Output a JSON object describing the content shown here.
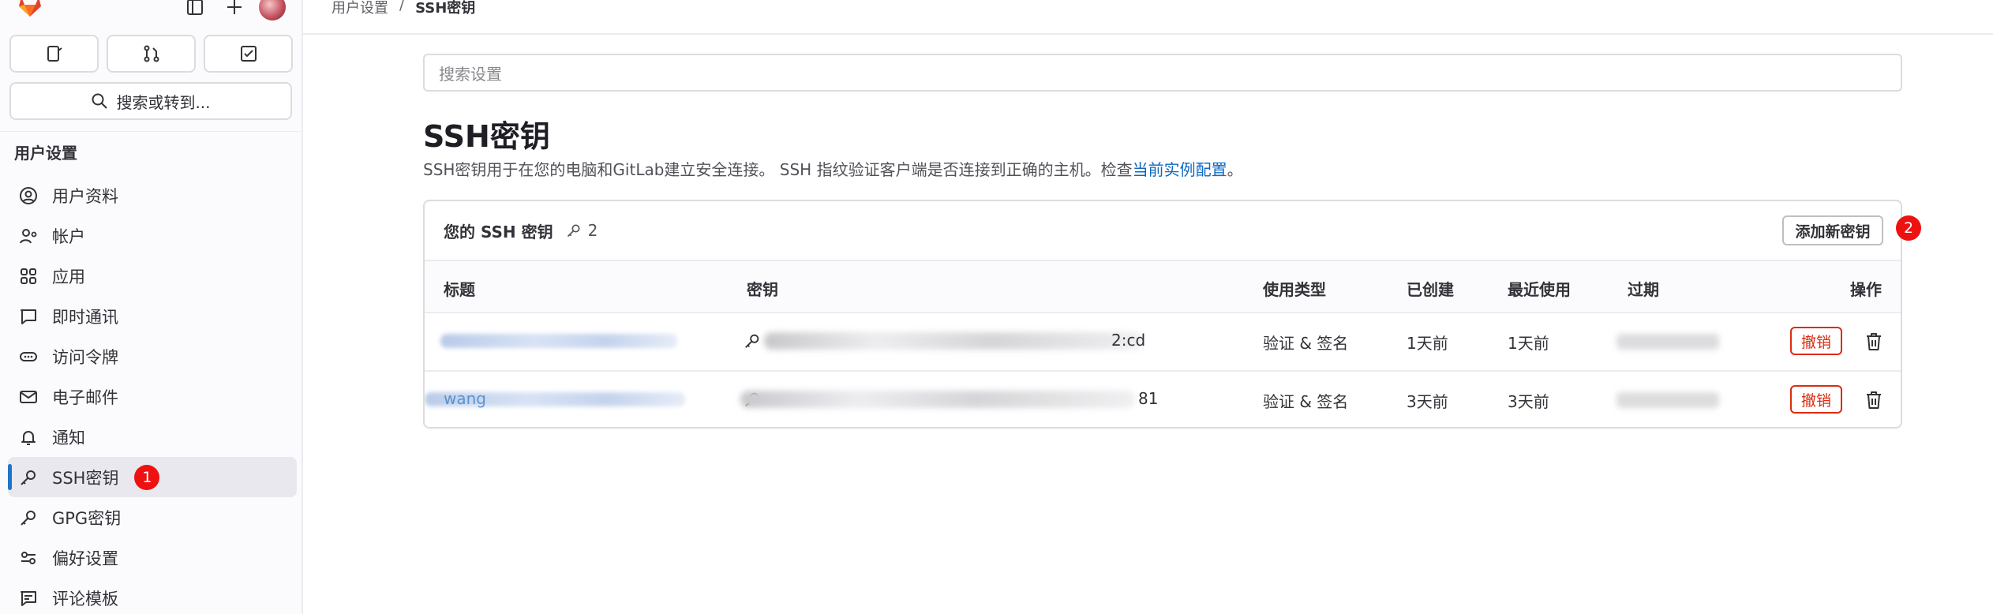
{
  "sidebar": {
    "search_label": "搜索或转到...",
    "section_title": "用户设置",
    "items": [
      {
        "label": "用户资料",
        "icon": "user-circle-icon"
      },
      {
        "label": "帐户",
        "icon": "account-icon"
      },
      {
        "label": "应用",
        "icon": "applications-icon"
      },
      {
        "label": "即时通讯",
        "icon": "chat-icon"
      },
      {
        "label": "访问令牌",
        "icon": "token-icon"
      },
      {
        "label": "电子邮件",
        "icon": "mail-icon"
      },
      {
        "label": "通知",
        "icon": "bell-icon"
      },
      {
        "label": "SSH密钥",
        "icon": "key-icon",
        "active": true,
        "badge": "1"
      },
      {
        "label": "GPG密钥",
        "icon": "key-icon"
      },
      {
        "label": "偏好设置",
        "icon": "preferences-icon"
      },
      {
        "label": "评论模板",
        "icon": "comment-template-icon"
      }
    ]
  },
  "breadcrumb": {
    "parent": "用户设置",
    "separator": "/",
    "current": "SSH密钥"
  },
  "main": {
    "search_placeholder": "搜索设置",
    "title": "SSH密钥",
    "description_prefix": "SSH密钥用于在您的电脑和GitLab建立安全连接。 SSH 指纹验证客户端是否连接到正确的主机。检查",
    "description_link": "当前实例配置",
    "description_suffix": "。",
    "card": {
      "title": "您的 SSH 密钥",
      "key_count": "2",
      "add_button": "添加新密钥",
      "add_badge": "2",
      "columns": [
        "标题",
        "密钥",
        "使用类型",
        "已创建",
        "最近使用",
        "过期",
        "操作"
      ],
      "rows": [
        {
          "title": "",
          "key_suffix": "2:cd",
          "usage": "验证 & 签名",
          "created": "1天前",
          "last_used": "1天前",
          "expires": "",
          "revoke": "撤销"
        },
        {
          "title": "wang",
          "key_suffix": "81",
          "usage": "验证 & 签名",
          "created": "3天前",
          "last_used": "3天前",
          "expires": "",
          "revoke": "撤销"
        }
      ]
    }
  },
  "colors": {
    "accent": "#1f75cb",
    "danger": "#dd2b0e",
    "badge": "#ee1111",
    "link": "#1068bf"
  }
}
